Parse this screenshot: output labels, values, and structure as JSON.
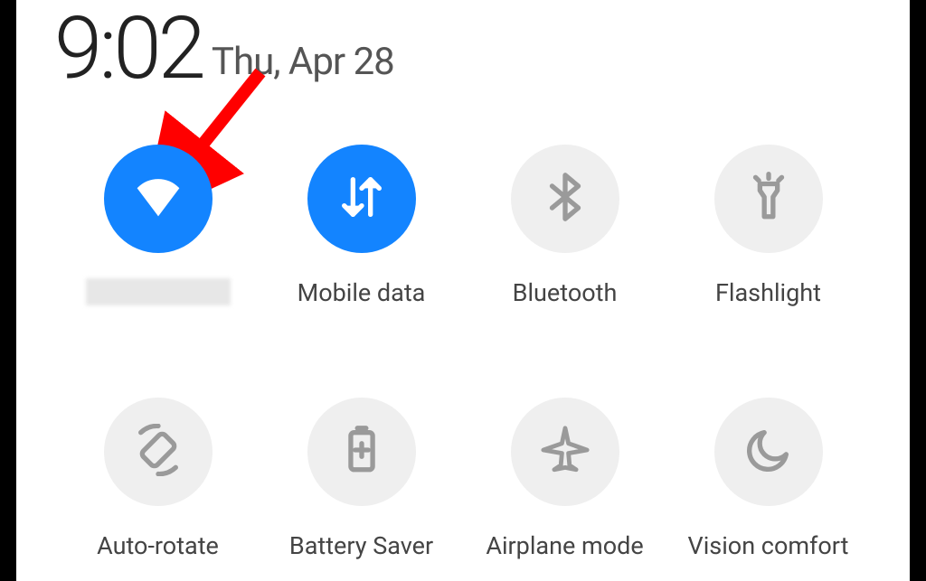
{
  "status": {
    "time": "9:02",
    "date": "Thu, Apr 28"
  },
  "tiles": {
    "wifi": {
      "label": "",
      "redacted": true,
      "active": true
    },
    "mobile_data": {
      "label": "Mobile data",
      "redacted": false,
      "active": true
    },
    "bluetooth": {
      "label": "Bluetooth",
      "redacted": false,
      "active": false
    },
    "flashlight": {
      "label": "Flashlight",
      "redacted": false,
      "active": false
    },
    "auto_rotate": {
      "label": "Auto-rotate",
      "redacted": false,
      "active": false
    },
    "battery_saver": {
      "label": "Battery Saver",
      "redacted": false,
      "active": false
    },
    "airplane_mode": {
      "label": "Airplane mode",
      "redacted": false,
      "active": false
    },
    "vision_comfort": {
      "label": "Vision comfort",
      "redacted": false,
      "active": false
    }
  },
  "annotation": {
    "type": "arrow",
    "color": "#ff0000",
    "target": "wifi-toggle"
  }
}
